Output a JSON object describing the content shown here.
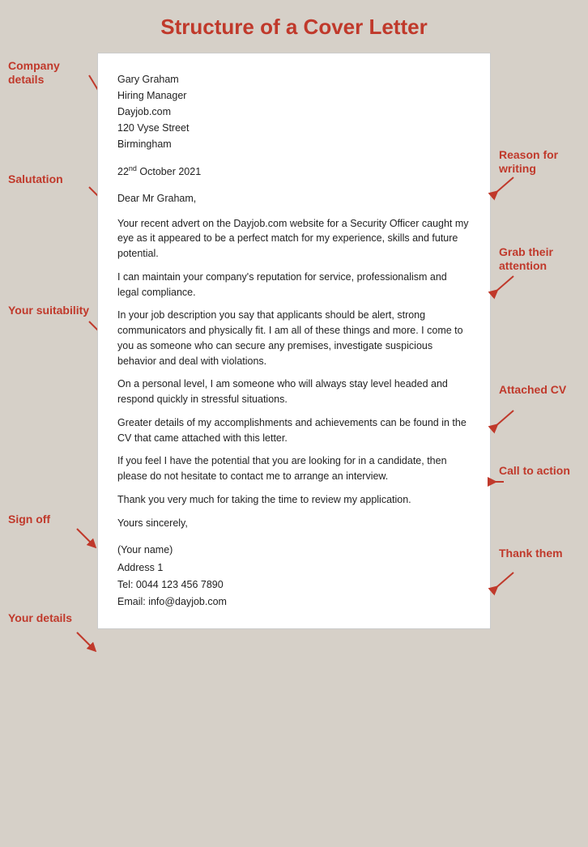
{
  "title": "Structure of a Cover Letter",
  "letter": {
    "recipient_name": "Gary Graham",
    "recipient_title": "Hiring Manager",
    "recipient_company": "Dayjob.com",
    "recipient_address1": "120  Vyse Street",
    "recipient_city": "Birmingham",
    "date": "22",
    "date_sup": "nd",
    "date_rest": "  October 2021",
    "salutation": "Dear Mr Graham,",
    "para1": "Your recent advert on the Dayjob.com  website for a Security Officer caught  my eye as it appeared to be a perfect match  for my experience, skills and future potential.",
    "para2": "I can  maintain your company's reputation for service, professionalism and legal compliance.",
    "para3": "In your job description you say that applicants should be alert, strong communicators and physically fit. I am all of these things and more. I come to you as someone who can  secure any premises, investigate suspicious behavior and deal with violations.",
    "para4": "On a personal level, I am someone who will always stay level headed and respond quickly in stressful situations.",
    "para5": "Greater details of my accomplishments and achievements can  be found in the CV that came attached with this letter.",
    "para6": "If you feel I have the potential that you are looking for in a candidate, then please do not hesitate to contact  me to arrange an interview.",
    "para7": "Thank you very much  for taking the time to review my application.",
    "signoff": "Yours sincerely,",
    "your_name": "(Your name)",
    "your_address": "Address 1",
    "your_tel": "Tel: 0044  123 456  7890",
    "your_email": "Email: info@dayjob.com"
  },
  "labels": {
    "company_details": "Company details",
    "salutation": "Salutation",
    "your_suitability": "Your suitability",
    "sign_off": "Sign off",
    "your_details": "Your details",
    "reason_for_writing": "Reason for writing",
    "grab_their_attention": "Grab their attention",
    "attached_cv": "Attached CV",
    "call_to_action": "Call to action",
    "thank_them": "Thank them"
  }
}
